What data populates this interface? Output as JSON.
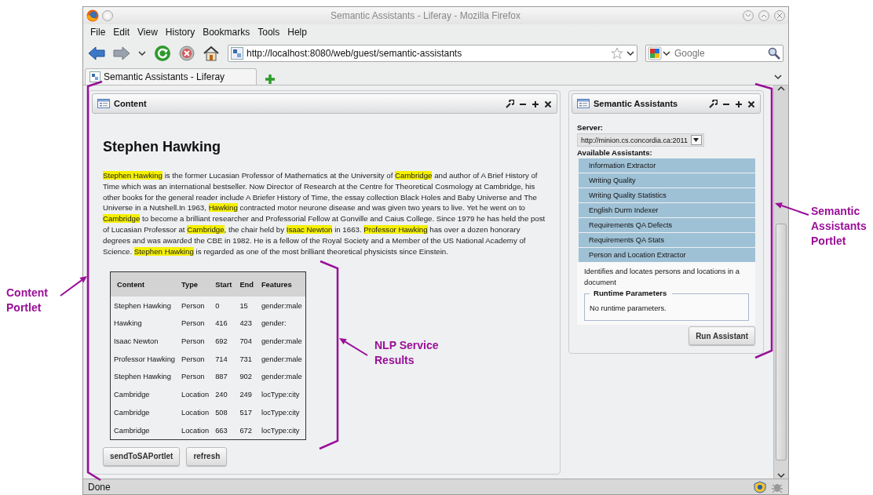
{
  "window": {
    "title": "Semantic Assistants - Liferay - Mozilla Firefox"
  },
  "menu": [
    "File",
    "Edit",
    "View",
    "History",
    "Bookmarks",
    "Tools",
    "Help"
  ],
  "address_bar": {
    "value": "http://localhost:8080/web/guest/semantic-assistants"
  },
  "search": {
    "placeholder": "Google"
  },
  "tabs": [
    {
      "label": "Semantic Assistants - Liferay",
      "selected": true
    }
  ],
  "content_portlet": {
    "title": "Content",
    "heading": "Stephen Hawking",
    "paragraph": [
      {
        "text": "Stephen Hawking",
        "highlighted": true
      },
      {
        "text": " is the former Lucasian Professor of Mathematics at the University of ",
        "highlighted": false
      },
      {
        "text": "Cambridge",
        "highlighted": true
      },
      {
        "text": " and author of A Brief History of Time which was an international bestseller. Now Director of Research at the Centre for Theoretical Cosmology at Cambridge, his other books for the general reader include A Briefer History of Time, the essay collection Black Holes and Baby Universe and The Universe in a Nutshell.In 1963, ",
        "highlighted": false
      },
      {
        "text": "Hawking",
        "highlighted": true
      },
      {
        "text": " contracted motor neurone disease and was given two years to live. Yet he went on to ",
        "highlighted": false
      },
      {
        "text": "Cambridge",
        "highlighted": true
      },
      {
        "text": " to become a brilliant researcher and Professorial Fellow at Gonville and Caius College. Since 1979 he has held the post of Lucasian Professor at ",
        "highlighted": false
      },
      {
        "text": "Cambridge",
        "highlighted": true
      },
      {
        "text": ", the chair held by ",
        "highlighted": false
      },
      {
        "text": "Isaac Newton",
        "highlighted": true
      },
      {
        "text": " in 1663. ",
        "highlighted": false
      },
      {
        "text": "Professor Hawking",
        "highlighted": true
      },
      {
        "text": " has over a dozen honorary degrees and was awarded the CBE in 1982. He is a fellow of the Royal Society and a Member of the US National Academy of Science. ",
        "highlighted": false
      },
      {
        "text": "Stephen Hawking",
        "highlighted": true
      },
      {
        "text": " is regarded as one of the most brilliant theoretical physicists since Einstein.",
        "highlighted": false
      }
    ],
    "table": {
      "columns": [
        "Content",
        "Type",
        "Start",
        "End",
        "Features"
      ],
      "rows": [
        [
          "Stephen Hawking",
          "Person",
          "0",
          "15",
          "gender:male"
        ],
        [
          "Hawking",
          "Person",
          "416",
          "423",
          "gender:"
        ],
        [
          "Isaac Newton",
          "Person",
          "692",
          "704",
          "gender:male"
        ],
        [
          "Professor Hawking",
          "Person",
          "714",
          "731",
          "gender:male"
        ],
        [
          "Stephen Hawking",
          "Person",
          "887",
          "902",
          "gender:male"
        ],
        [
          "Cambridge",
          "Location",
          "240",
          "249",
          "locType:city"
        ],
        [
          "Cambridge",
          "Location",
          "508",
          "517",
          "locType:city"
        ],
        [
          "Cambridge",
          "Location",
          "663",
          "672",
          "locType:city"
        ]
      ]
    },
    "buttons": [
      "sendToSAPortlet",
      "refresh"
    ]
  },
  "sa_portlet": {
    "title": "Semantic Assistants",
    "server_label": "Server:",
    "server_value": "http://minion.cs.concordia.ca:2011",
    "assistants_label": "Available Assistants:",
    "assistants": [
      "Information Extractor",
      "Writing Quality",
      "Writing Quality Statistics",
      "English Durm Indexer",
      "Requirements QA Defects",
      "Requirements QA Stats",
      "Person and Location Extractor"
    ],
    "description": "Identifies and locates persons and locations in a document",
    "runtime_title": "Runtime Parameters",
    "runtime_text": "No runtime parameters.",
    "button": "Run Assistant"
  },
  "status_bar": {
    "text": "Done"
  },
  "annotations": [
    "Content Portlet",
    "NLP Service Results",
    "Semantic Assistants Portlet"
  ]
}
